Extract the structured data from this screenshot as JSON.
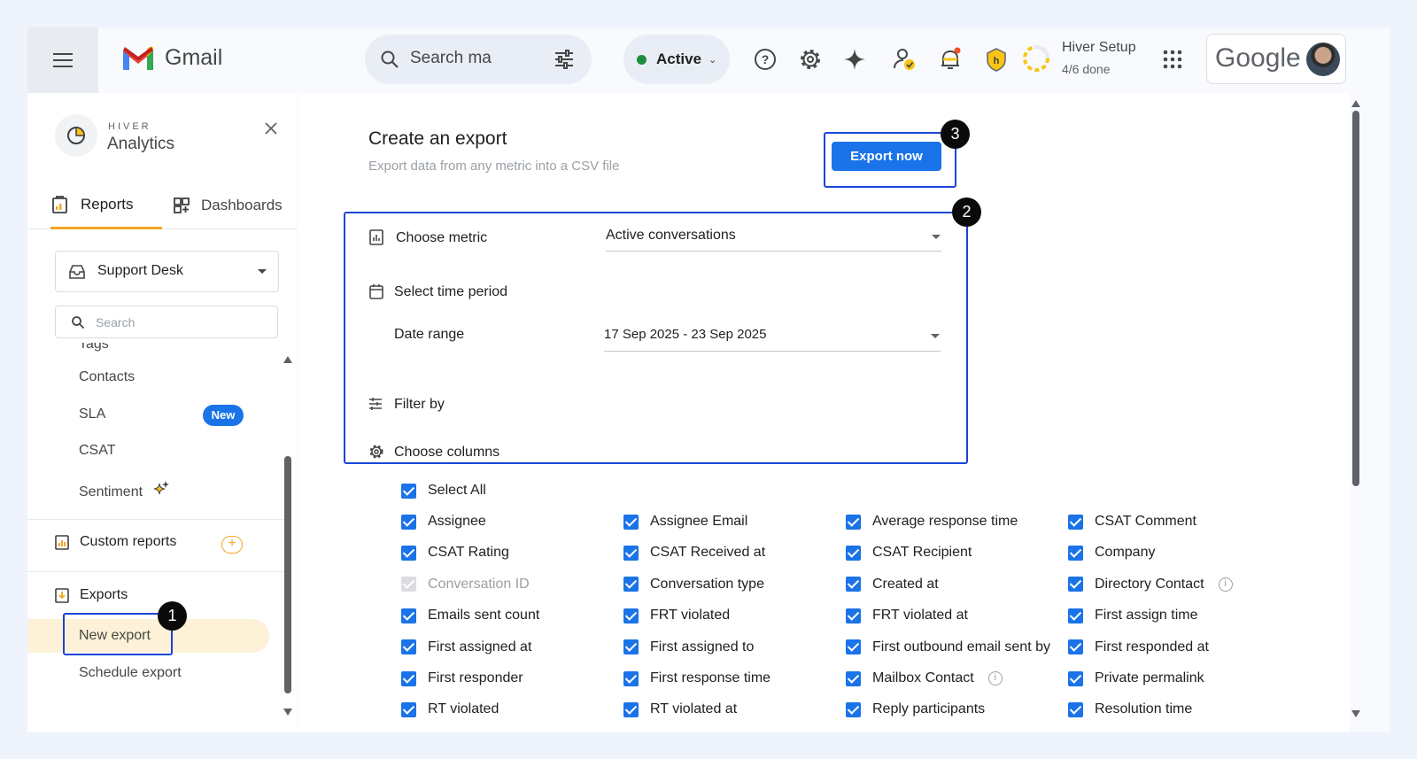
{
  "topbar": {
    "app_name": "Gmail",
    "search_placeholder": "Search ma",
    "status_label": "Active",
    "status_color": "#1e8e3e",
    "hiver_setup_title": "Hiver Setup",
    "hiver_setup_progress": "4/6 done",
    "google_label": "Google",
    "icons": [
      "menu-icon",
      "search-icon",
      "tune-icon",
      "help-icon",
      "gear-icon",
      "gemini-icon",
      "contact-check-icon",
      "bell-icon",
      "hiver-shield-icon",
      "progress-ring-icon",
      "apps-grid-icon"
    ]
  },
  "sidebar": {
    "brand": "HIVER",
    "title": "Analytics",
    "tabs": [
      {
        "label": "Reports",
        "active": true
      },
      {
        "label": "Dashboards",
        "active": false
      }
    ],
    "inbox_select": "Support Desk",
    "search_placeholder": "Search",
    "items": [
      {
        "label": "Tags"
      },
      {
        "label": "Contacts"
      },
      {
        "label": "SLA",
        "badge": "New"
      },
      {
        "label": "CSAT"
      },
      {
        "label": "Sentiment"
      }
    ],
    "custom_reports_label": "Custom reports",
    "exports_label": "Exports",
    "export_items": [
      {
        "label": "New export",
        "active": true
      },
      {
        "label": "Schedule export"
      }
    ],
    "accent_color": "#f5a623"
  },
  "main": {
    "title": "Create an export",
    "subtitle": "Export data from any metric into a CSV file",
    "export_button": "Export now",
    "choose_metric_label": "Choose metric",
    "metric_value": "Active conversations",
    "time_period_label": "Select time period",
    "date_range_label": "Date range",
    "date_range_value": "17 Sep 2025 - 23 Sep 2025",
    "filter_label": "Filter by",
    "columns_label": "Choose columns",
    "select_all_label": "Select All",
    "columns": [
      {
        "label": "Assignee",
        "checked": true
      },
      {
        "label": "Assignee Email",
        "checked": true
      },
      {
        "label": "Average response time",
        "checked": true
      },
      {
        "label": "CSAT Comment",
        "checked": true
      },
      {
        "label": "CSAT Rating",
        "checked": true
      },
      {
        "label": "CSAT Received at",
        "checked": true
      },
      {
        "label": "CSAT Recipient",
        "checked": true
      },
      {
        "label": "Company",
        "checked": true
      },
      {
        "label": "Conversation ID",
        "checked": true,
        "disabled": true
      },
      {
        "label": "Conversation type",
        "checked": true
      },
      {
        "label": "Created at",
        "checked": true
      },
      {
        "label": "Directory Contact",
        "checked": true,
        "info": true
      },
      {
        "label": "Emails sent count",
        "checked": true
      },
      {
        "label": "FRT violated",
        "checked": true
      },
      {
        "label": "FRT violated at",
        "checked": true
      },
      {
        "label": "First assign time",
        "checked": true
      },
      {
        "label": "First assigned at",
        "checked": true
      },
      {
        "label": "First assigned to",
        "checked": true
      },
      {
        "label": "First outbound email sent by",
        "checked": true
      },
      {
        "label": "First responded at",
        "checked": true
      },
      {
        "label": "First responder",
        "checked": true
      },
      {
        "label": "First response time",
        "checked": true
      },
      {
        "label": "Mailbox Contact",
        "checked": true,
        "info": true
      },
      {
        "label": "Private permalink",
        "checked": true
      },
      {
        "label": "RT violated",
        "checked": true
      },
      {
        "label": "RT violated at",
        "checked": true
      },
      {
        "label": "Reply participants",
        "checked": true
      },
      {
        "label": "Resolution time",
        "checked": true
      }
    ],
    "step_badges": [
      "1",
      "2",
      "3"
    ],
    "highlight_color": "#1a45d8",
    "primary_color": "#1a73e8"
  }
}
